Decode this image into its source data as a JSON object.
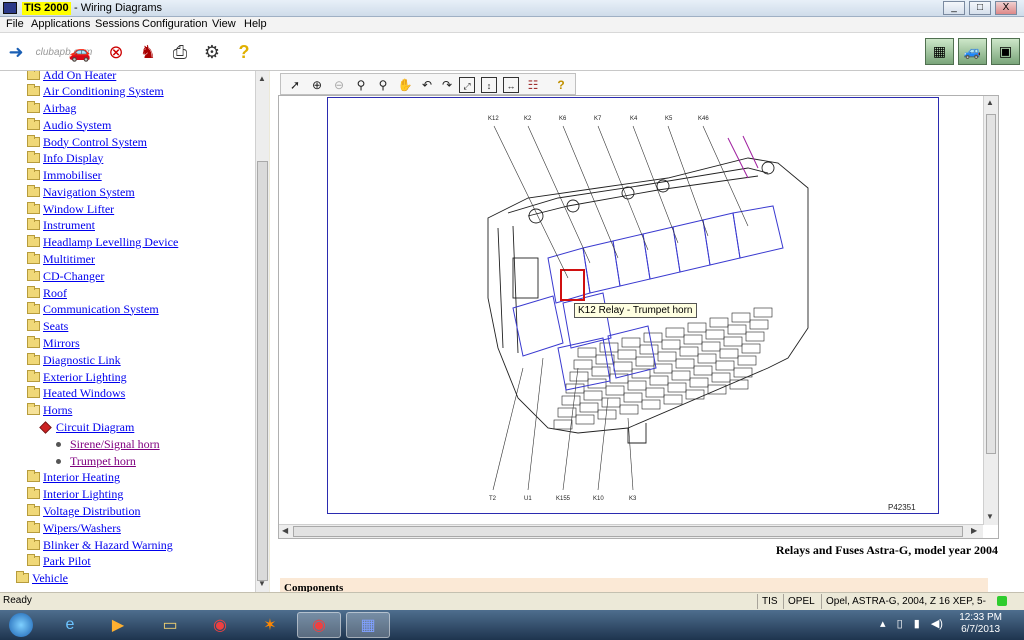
{
  "window": {
    "app_name": "TIS 2000",
    "title_suffix": "- Wiring Diagrams",
    "minimize": "_",
    "maximize": "□",
    "close": "X"
  },
  "menu": [
    "File",
    "Applications",
    "Sessions",
    "Configuration",
    "View",
    "Help"
  ],
  "toolbar": {
    "watermark": "clubapb.com",
    "icons": [
      "exit-icon",
      "car-icon",
      "stop-icon",
      "person-icon",
      "print-icon",
      "tools-icon",
      "help-icon"
    ],
    "right_icons": [
      "module-a-icon",
      "vehicle-icon",
      "car-photo-icon"
    ]
  },
  "tree": {
    "items": [
      {
        "label": "Add On Heater",
        "type": "folder"
      },
      {
        "label": "Air Conditioning System",
        "type": "folder"
      },
      {
        "label": "Airbag",
        "type": "folder"
      },
      {
        "label": "Audio System",
        "type": "folder"
      },
      {
        "label": "Body Control System",
        "type": "folder"
      },
      {
        "label": "Info Display",
        "type": "folder"
      },
      {
        "label": "Immobiliser",
        "type": "folder"
      },
      {
        "label": "Navigation System",
        "type": "folder"
      },
      {
        "label": "Window Lifter",
        "type": "folder"
      },
      {
        "label": "Instrument",
        "type": "folder"
      },
      {
        "label": "Headlamp Levelling Device",
        "type": "folder"
      },
      {
        "label": "Multitimer",
        "type": "folder"
      },
      {
        "label": "CD-Changer",
        "type": "folder"
      },
      {
        "label": "Roof",
        "type": "folder"
      },
      {
        "label": "Communication System",
        "type": "folder"
      },
      {
        "label": "Seats",
        "type": "folder"
      },
      {
        "label": "Mirrors",
        "type": "folder"
      },
      {
        "label": "Diagnostic Link",
        "type": "folder"
      },
      {
        "label": "Exterior Lighting",
        "type": "folder"
      },
      {
        "label": "Heated Windows",
        "type": "folder"
      },
      {
        "label": "Horns",
        "type": "folder-open"
      },
      {
        "label": "Circuit Diagram",
        "type": "diagram"
      },
      {
        "label": "Sirene/Signal horn",
        "type": "leaf"
      },
      {
        "label": "Trumpet horn",
        "type": "leaf"
      },
      {
        "label": "Interior Heating",
        "type": "folder"
      },
      {
        "label": "Interior Lighting",
        "type": "folder"
      },
      {
        "label": "Voltage Distribution",
        "type": "folder"
      },
      {
        "label": "Wipers/Washers",
        "type": "folder"
      },
      {
        "label": "Blinker & Hazard Warning",
        "type": "folder"
      },
      {
        "label": "Park Pilot",
        "type": "folder"
      },
      {
        "label": "Vehicle",
        "type": "folder-root"
      }
    ]
  },
  "viewer_toolbar": {
    "tools": [
      "pointer-icon",
      "zoom-in-icon",
      "zoom-out-icon",
      "zoom-icon",
      "zoom-area-icon",
      "pan-hand-icon",
      "rotate-left-icon",
      "rotate-right-icon",
      "fit-all-icon",
      "fit-height-icon",
      "fit-width-icon",
      "layers-icon",
      "help-icon"
    ]
  },
  "drawing": {
    "top_labels": [
      "K12",
      "K2",
      "K6",
      "K7",
      "K4",
      "K5",
      "K46"
    ],
    "bottom_labels": [
      "T2",
      "U1",
      "K155",
      "K10",
      "K3"
    ],
    "ref_code": "P42351",
    "tooltip": "K12 Relay - Trumpet horn",
    "highlight_color": "#d01010",
    "relay_color": "#3a3ad0"
  },
  "document": {
    "title": "Relays and Fuses Astra-G, model year 2004",
    "section": "Components"
  },
  "status": {
    "ready": "Ready",
    "fields": [
      "TIS",
      "OPEL",
      "Opel, ASTRA-G, 2004, Z 16 XEP, 5-MT"
    ]
  },
  "taskbar": {
    "apps": [
      "start-icon",
      "ie-icon",
      "media-icon",
      "explorer-icon",
      "chrome-icon",
      "avast-icon",
      "chrome-icon-active",
      "tis-icon"
    ],
    "time": "12:33 PM",
    "date": "6/7/2013"
  }
}
